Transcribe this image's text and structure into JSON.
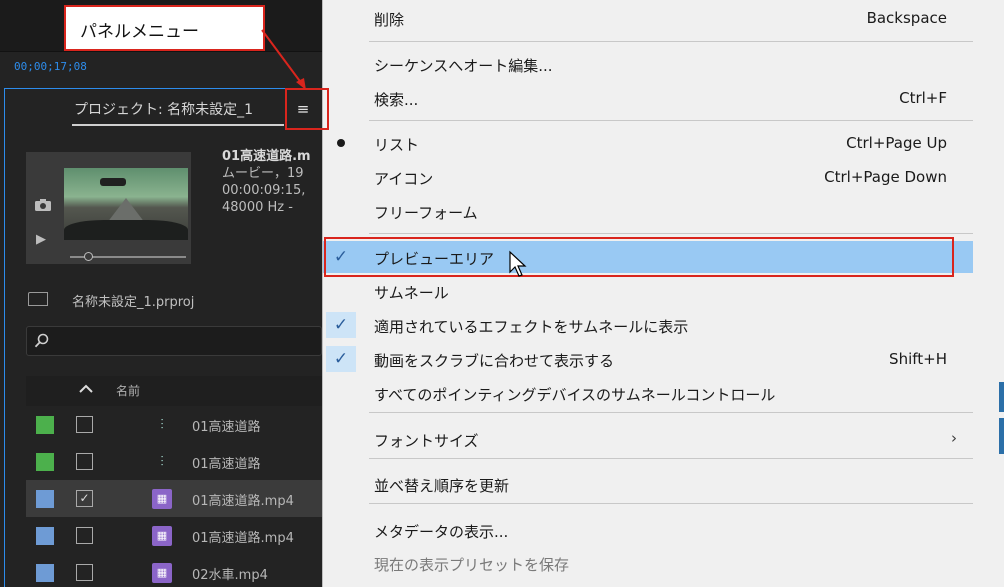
{
  "timecode": "00;00;17;08",
  "callout": {
    "text": "パネルメニュー"
  },
  "project": {
    "tab_label": "プロジェクト: 名称未設定_1",
    "panel_menu_glyph": "≡",
    "preview": {
      "clip_name": "01高速道路.m",
      "type_line": "ムービー，19",
      "duration_line": "00:00:09:15,",
      "audio_line": "48000 Hz - "
    },
    "project_file": "名称未設定_1.prproj",
    "list_header": {
      "name_column": "名前"
    },
    "rows": [
      {
        "label": "01高速道路",
        "type": "sequence",
        "color": "#4cb04c",
        "checked": false,
        "selected": false
      },
      {
        "label": "01高速道路",
        "type": "sequence",
        "color": "#4cb04c",
        "checked": false,
        "selected": false
      },
      {
        "label": "01高速道路.mp4",
        "type": "clip",
        "color": "#6e9bd5",
        "checked": true,
        "selected": true
      },
      {
        "label": "01高速道路.mp4",
        "type": "clip",
        "color": "#6e9bd5",
        "checked": false,
        "selected": false
      },
      {
        "label": "02水車.mp4",
        "type": "clip",
        "color": "#6e9bd5",
        "checked": false,
        "selected": false
      }
    ]
  },
  "menu": {
    "items": [
      {
        "label": "削除",
        "shortcut": "Backspace"
      },
      {
        "label": "シーケンスへオート編集..."
      },
      {
        "label": "検索...",
        "shortcut": "Ctrl+F"
      },
      {
        "label": "リスト",
        "shortcut": "Ctrl+Page Up",
        "mark": "bullet"
      },
      {
        "label": "アイコン",
        "shortcut": "Ctrl+Page Down"
      },
      {
        "label": "フリーフォーム"
      },
      {
        "label": "プレビューエリア",
        "mark": "check",
        "highlighted": true
      },
      {
        "label": "サムネール"
      },
      {
        "label": "適用されているエフェクトをサムネールに表示",
        "mark": "check"
      },
      {
        "label": "動画をスクラブに合わせて表示する",
        "shortcut": "Shift+H",
        "mark": "check"
      },
      {
        "label": "すべてのポインティングデバイスのサムネールコントロール"
      },
      {
        "label": "フォントサイズ",
        "submenu": true
      },
      {
        "label": "並べ替え順序を更新"
      },
      {
        "label": "メタデータの表示..."
      },
      {
        "label": "現在の表示プリセットを保存",
        "disabled": true
      }
    ]
  },
  "colors": {
    "accent": "#2d8ceb",
    "annotation_red": "#d9251d",
    "menu_highlight": "#99c9f3"
  }
}
